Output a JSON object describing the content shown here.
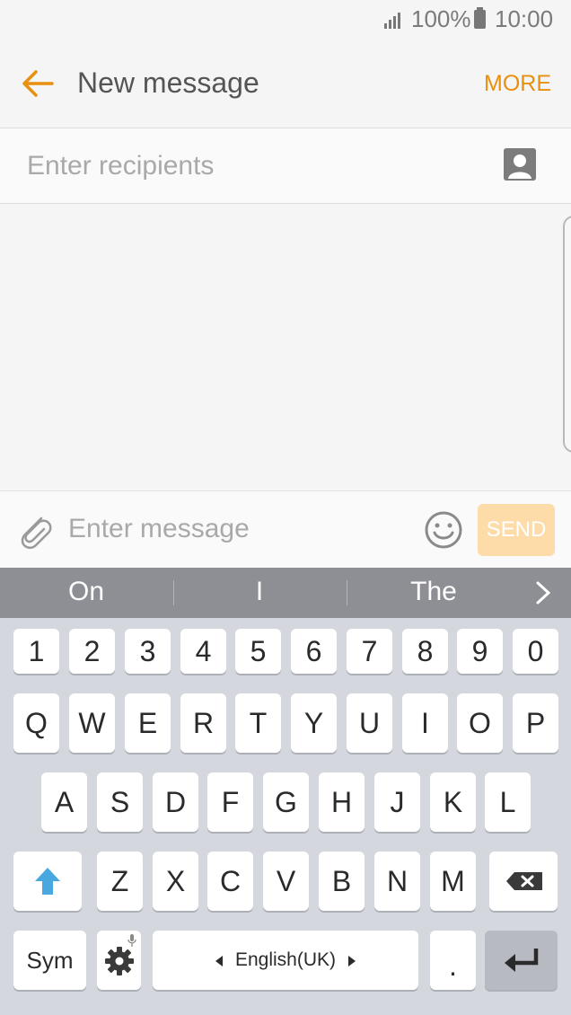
{
  "status_bar": {
    "battery_percent": "100%",
    "time": "10:00",
    "signal_icon": "signal-icon",
    "battery_icon": "battery-icon"
  },
  "app_bar": {
    "title": "New message",
    "more_label": "MORE",
    "back_icon": "back-arrow-icon"
  },
  "recipients": {
    "placeholder": "Enter recipients",
    "contact_icon": "contact-icon"
  },
  "compose": {
    "placeholder": "Enter message",
    "send_label": "SEND",
    "attach_icon": "paperclip-icon",
    "emoji_icon": "emoji-icon"
  },
  "suggestions": [
    "On",
    "I",
    "The"
  ],
  "keyboard": {
    "number_row": [
      "1",
      "2",
      "3",
      "4",
      "5",
      "6",
      "7",
      "8",
      "9",
      "0"
    ],
    "row1": [
      "Q",
      "W",
      "E",
      "R",
      "T",
      "Y",
      "U",
      "I",
      "O",
      "P"
    ],
    "row2": [
      "A",
      "S",
      "D",
      "F",
      "G",
      "H",
      "J",
      "K",
      "L"
    ],
    "row3": [
      "Z",
      "X",
      "C",
      "V",
      "B",
      "N",
      "M"
    ],
    "sym_label": "Sym",
    "space_label": "English(UK)",
    "period_label": "."
  },
  "colors": {
    "accent": "#e8900f",
    "send_disabled": "#fddcaa",
    "suggestion_bar": "#8e8f95",
    "shift_active": "#4aa8e0"
  }
}
